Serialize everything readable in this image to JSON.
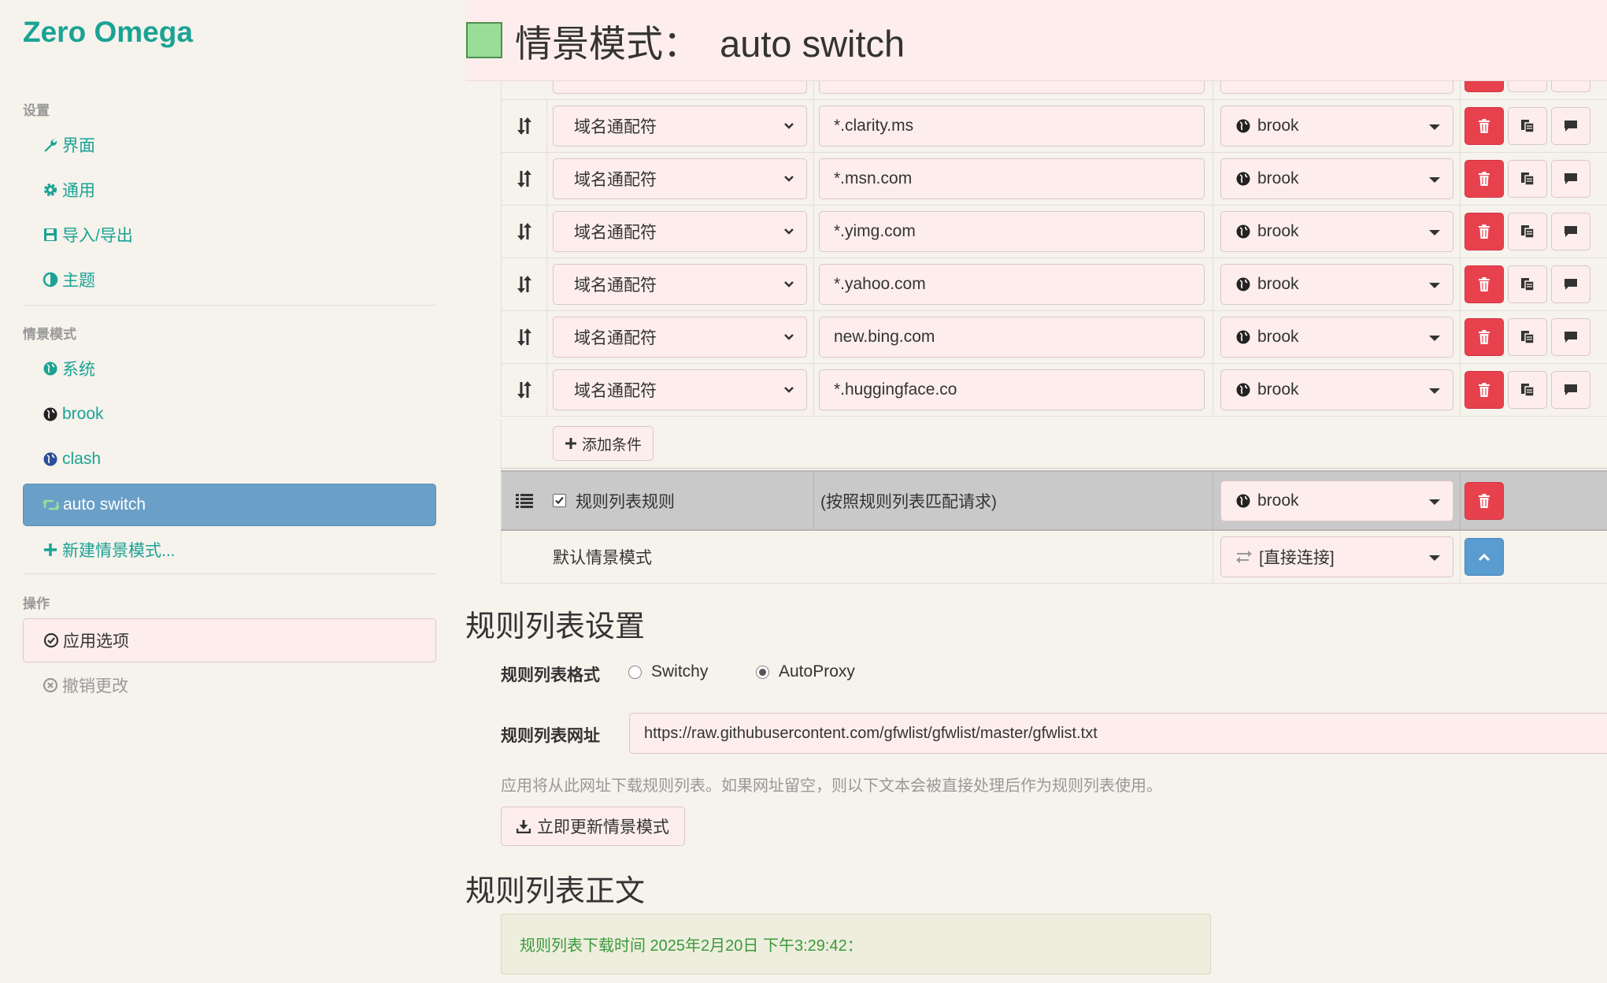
{
  "brand": "Zero Omega",
  "sidebar": {
    "settings_header": "设置",
    "settings_items": [
      {
        "label": "界面",
        "icon": "wrench-icon"
      },
      {
        "label": "通用",
        "icon": "gear-icon"
      },
      {
        "label": "导入/导出",
        "icon": "floppy-icon"
      },
      {
        "label": "主题",
        "icon": "contrast-icon"
      }
    ],
    "profiles_header": "情景模式",
    "profile_items": [
      {
        "label": "系统",
        "icon": "globe-icon"
      },
      {
        "label": "brook",
        "icon": "globe-icon"
      },
      {
        "label": "clash",
        "icon": "globe-icon"
      },
      {
        "label": "auto switch",
        "icon": "retweet-icon"
      }
    ],
    "new_profile": "新建情景模式...",
    "actions_header": "操作",
    "apply": "应用选项",
    "undo": "撤销更改"
  },
  "header": {
    "prefix": "情景模式：",
    "name": "auto switch",
    "color": "#99dd99"
  },
  "rules": [
    {
      "type": "域名通配符",
      "pattern": "*.clarity.ms",
      "profile": "brook"
    },
    {
      "type": "域名通配符",
      "pattern": "*.msn.com",
      "profile": "brook"
    },
    {
      "type": "域名通配符",
      "pattern": "*.yimg.com",
      "profile": "brook"
    },
    {
      "type": "域名通配符",
      "pattern": "*.yahoo.com",
      "profile": "brook"
    },
    {
      "type": "域名通配符",
      "pattern": "new.bing.com",
      "profile": "brook"
    },
    {
      "type": "域名通配符",
      "pattern": "*.huggingface.co",
      "profile": "brook"
    }
  ],
  "add_condition": "添加条件",
  "ruleset_row": {
    "label": "规则列表规则",
    "description": "(按照规则列表匹配请求)",
    "profile": "brook"
  },
  "default_row": {
    "label": "默认情景模式",
    "profile": "[直接连接]"
  },
  "ruleset_settings": {
    "title": "规则列表设置",
    "format_label": "规则列表格式",
    "format_options": [
      "Switchy",
      "AutoProxy"
    ],
    "format_selected": "AutoProxy",
    "url_label": "规则列表网址",
    "url_value": "https://raw.githubusercontent.com/gfwlist/gfwlist/master/gfwlist.txt",
    "help": "应用将从此网址下载规则列表。如果网址留空，则以下文本会被直接处理后作为规则列表使用。",
    "update_button": "立即更新情景模式"
  },
  "ruleset_text": {
    "title": "规则列表正文",
    "download_info": "规则列表下载时间 2025年2月20日 下午3:29:42："
  },
  "colors": {
    "accent": "#1aa394",
    "active_nav": "#6a9fc7",
    "delete": "#e8414e",
    "input_bg": "#fdeeed"
  }
}
